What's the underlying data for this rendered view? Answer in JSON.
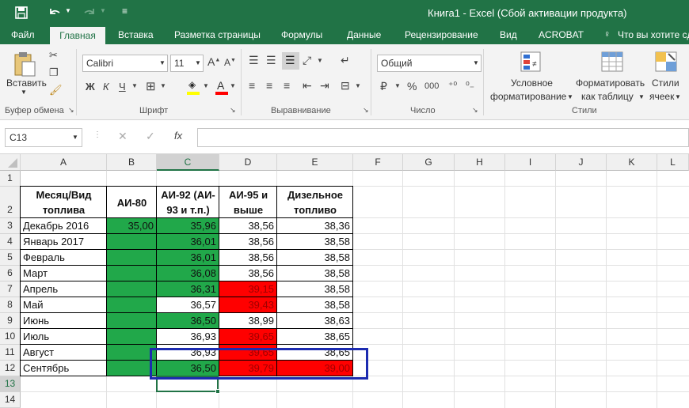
{
  "title": "Книга1 - Excel (Сбой активации продукта)",
  "qat": {
    "save": "save-icon",
    "undo": "undo-icon",
    "redo": "redo-icon",
    "customize": "customize-icon"
  },
  "tabs": [
    "Файл",
    "Главная",
    "Вставка",
    "Разметка страницы",
    "Формулы",
    "Данные",
    "Рецензирование",
    "Вид",
    "ACROBAT",
    "Что вы хотите сд"
  ],
  "ribbon": {
    "paste_label": "Вставить",
    "clipboard_group": "Буфер обмена",
    "font_name": "Calibri",
    "font_size": "11",
    "font_group": "Шрифт",
    "align_group": "Выравнивание",
    "number_format": "Общий",
    "number_group": "Число",
    "cond_format_l1": "Условное",
    "cond_format_l2": "форматирование",
    "format_table_l1": "Форматировать",
    "format_table_l2": "как таблицу",
    "styles_l1": "Стили",
    "styles_l2": "ячеек",
    "styles_group": "Стили",
    "bold": "Ж",
    "italic": "К",
    "underline": "Ч",
    "percent": "%",
    "thousands": "000"
  },
  "formula_bar": {
    "name_box": "C13",
    "fx": "fx",
    "value": ""
  },
  "columns": [
    "A",
    "B",
    "C",
    "D",
    "E",
    "F",
    "G",
    "H",
    "I",
    "J",
    "K",
    "L"
  ],
  "rows": [
    "1",
    "2",
    "3",
    "4",
    "5",
    "6",
    "7",
    "8",
    "9",
    "10",
    "11",
    "12",
    "13",
    "14"
  ],
  "headers": {
    "a": "Месяц/Вид топлива",
    "b": "АИ-80",
    "c": "АИ-92 (АИ-93 и т.п.)",
    "d": "АИ-95 и выше",
    "e": "Дизельное топливо"
  },
  "header_lines": {
    "a": [
      "Месяц/Вид",
      "топлива"
    ],
    "b": [
      "АИ-80"
    ],
    "c": [
      "АИ-92 (АИ-",
      "93 и т.п.)"
    ],
    "d": [
      "АИ-95 и",
      "выше"
    ],
    "e": [
      "Дизельное",
      "топливо"
    ]
  },
  "table": [
    {
      "month": "Декабрь 2016",
      "b": "35,00",
      "c": "35,96",
      "d": "38,56",
      "e": "38,36"
    },
    {
      "month": "Январь 2017",
      "b": "",
      "c": "36,01",
      "d": "38,56",
      "e": "38,58"
    },
    {
      "month": "Февраль",
      "b": "",
      "c": "36,01",
      "d": "38,56",
      "e": "38,58"
    },
    {
      "month": "Март",
      "b": "",
      "c": "36,08",
      "d": "38,56",
      "e": "38,58"
    },
    {
      "month": "Апрель",
      "b": "",
      "c": "36,31",
      "d": "39,15",
      "e": "38,58"
    },
    {
      "month": "Май",
      "b": "",
      "c": "36,57",
      "d": "39,43",
      "e": "38,58"
    },
    {
      "month": "Июнь",
      "b": "",
      "c": "36,50",
      "d": "38,99",
      "e": "38,63"
    },
    {
      "month": "Июль",
      "b": "",
      "c": "36,93",
      "d": "39,65",
      "e": "38,65"
    },
    {
      "month": "Август",
      "b": "",
      "c": "36,93",
      "d": "39,65",
      "e": "38,65"
    },
    {
      "month": "Сентябрь",
      "b": "",
      "c": "36,50",
      "d": "39,79",
      "e": "39,00"
    }
  ],
  "fills": [
    {
      "b": "green",
      "c": "green",
      "d": "white",
      "e": "white"
    },
    {
      "b": "green",
      "c": "green",
      "d": "white",
      "e": "white"
    },
    {
      "b": "green",
      "c": "green",
      "d": "white",
      "e": "white"
    },
    {
      "b": "green",
      "c": "green",
      "d": "white",
      "e": "white"
    },
    {
      "b": "green",
      "c": "green",
      "d": "red",
      "e": "white"
    },
    {
      "b": "green",
      "c": "white",
      "d": "red",
      "e": "white"
    },
    {
      "b": "green",
      "c": "green",
      "d": "white",
      "e": "white"
    },
    {
      "b": "green",
      "c": "white",
      "d": "red",
      "e": "white"
    },
    {
      "b": "green",
      "c": "white",
      "d": "red",
      "e": "white"
    },
    {
      "b": "green",
      "c": "green",
      "d": "red",
      "e": "red"
    }
  ],
  "colors": {
    "excel_green": "#217346",
    "green_fill": "#21a84a",
    "red_fill": "#ff0000",
    "annotation_blue": "#1c2bb0",
    "selection": "#217346"
  }
}
